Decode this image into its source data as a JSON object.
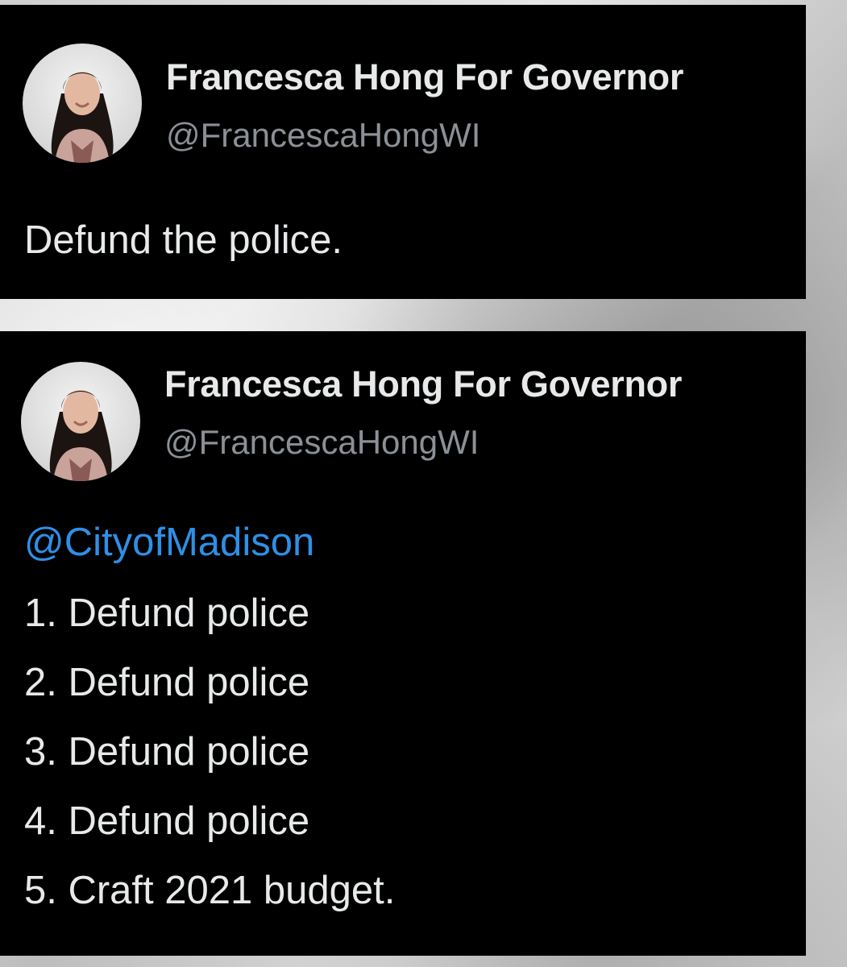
{
  "tweets": [
    {
      "display_name": "Francesca Hong For Governor",
      "handle": "@FrancescaHongWI",
      "avatar_icon": "profile-photo-avatar",
      "text": "Defund the police."
    },
    {
      "display_name": "Francesca Hong For Governor",
      "handle": "@FrancescaHongWI",
      "avatar_icon": "profile-photo-avatar",
      "mention": "@CityofMadison",
      "list_items": [
        "1. Defund police",
        "2. Defund police",
        "3. Defund police",
        "4. Defund police",
        "5. Craft 2021 budget."
      ]
    }
  ],
  "colors": {
    "card_background": "#000000",
    "name_text": "#e7e9ea",
    "handle_text": "#8b9096",
    "mention_link": "#2f8fe6"
  }
}
